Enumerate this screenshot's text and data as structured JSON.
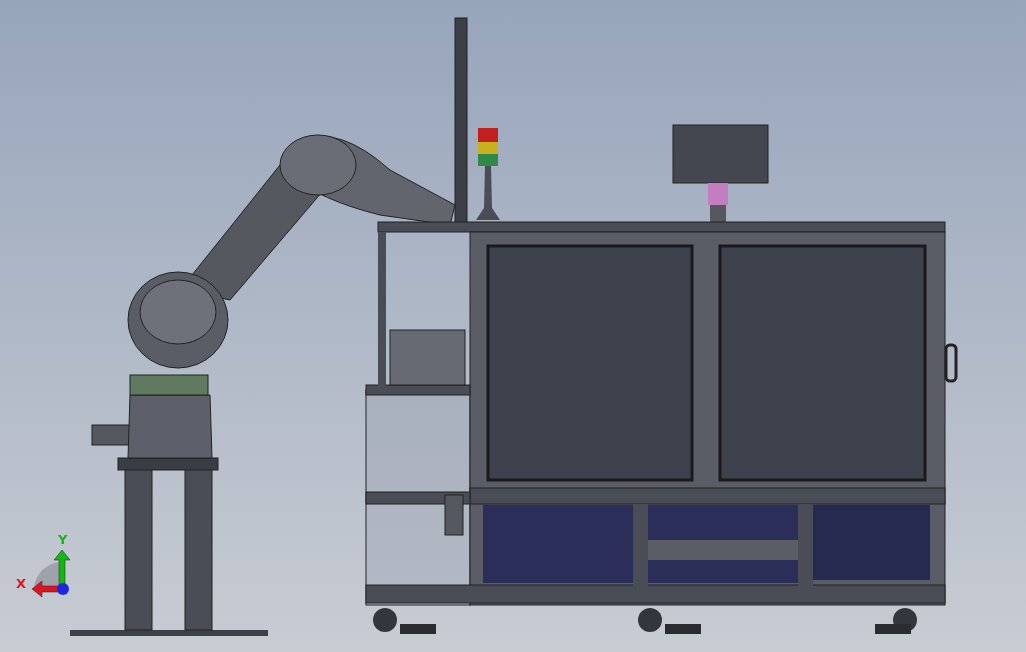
{
  "viewport": {
    "triad": {
      "axes": [
        {
          "label": "X",
          "color": "#e0141e"
        },
        {
          "label": "Y",
          "color": "#12b812"
        }
      ]
    }
  }
}
